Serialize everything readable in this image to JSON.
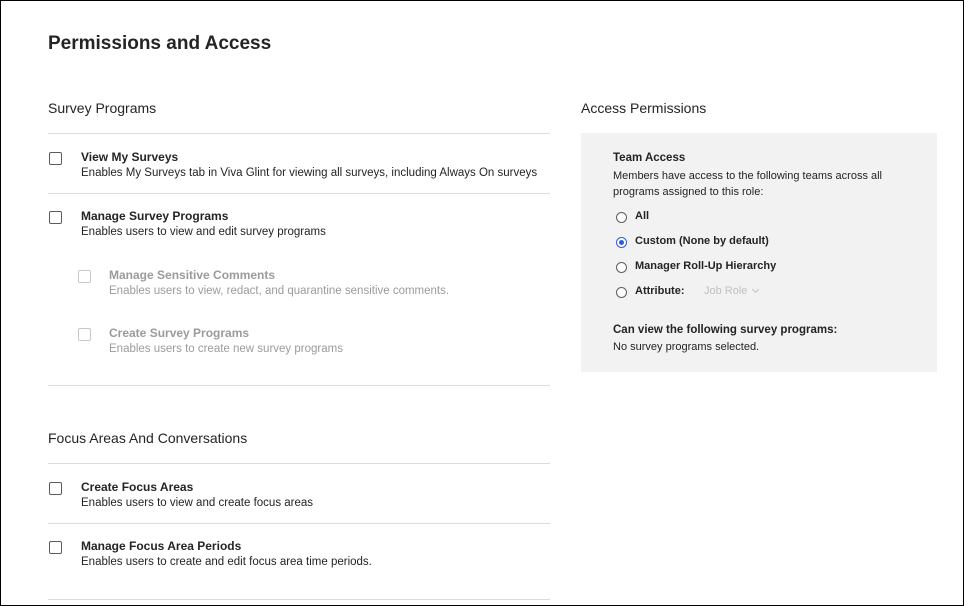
{
  "page": {
    "title": "Permissions and Access"
  },
  "survey_programs": {
    "title": "Survey Programs",
    "items": [
      {
        "label": "View My Surveys",
        "description": "Enables My Surveys tab in Viva Glint for viewing all surveys, including Always On surveys",
        "checked": false
      },
      {
        "label": "Manage Survey Programs",
        "description": "Enables users to view and edit survey programs",
        "checked": false
      },
      {
        "label": "Manage Sensitive Comments",
        "description": "Enables users to view, redact, and quarantine sensitive comments.",
        "checked": false,
        "disabled": true
      },
      {
        "label": "Create Survey Programs",
        "description": "Enables users to create new survey programs",
        "checked": false,
        "disabled": true
      }
    ]
  },
  "focus_areas": {
    "title": "Focus Areas And Conversations",
    "items": [
      {
        "label": "Create Focus Areas",
        "description": "Enables users to view and create focus areas",
        "checked": false
      },
      {
        "label": "Manage Focus Area Periods",
        "description": "Enables users to create and edit focus area time periods.",
        "checked": false
      }
    ]
  },
  "access_permissions": {
    "title": "Access Permissions",
    "team_access": {
      "heading": "Team Access",
      "description": "Members have access to the following teams across all programs assigned to this role:",
      "options": [
        {
          "label": "All",
          "checked": false
        },
        {
          "label": "Custom (None by default)",
          "checked": true
        },
        {
          "label": "Manager Roll-Up Hierarchy",
          "checked": false
        },
        {
          "label": "Attribute:",
          "checked": false
        }
      ],
      "attribute_select": {
        "value": "Job Role",
        "icon": "chevron-down-icon"
      }
    },
    "survey_programs_view": {
      "heading": "Can view the following survey programs:",
      "value": "No survey programs selected."
    }
  },
  "colors": {
    "accent": "#2f5cd7",
    "panel_bg": "#f2f2f2",
    "divider": "#dcdcdc",
    "disabled_text": "#9b9b9b"
  }
}
